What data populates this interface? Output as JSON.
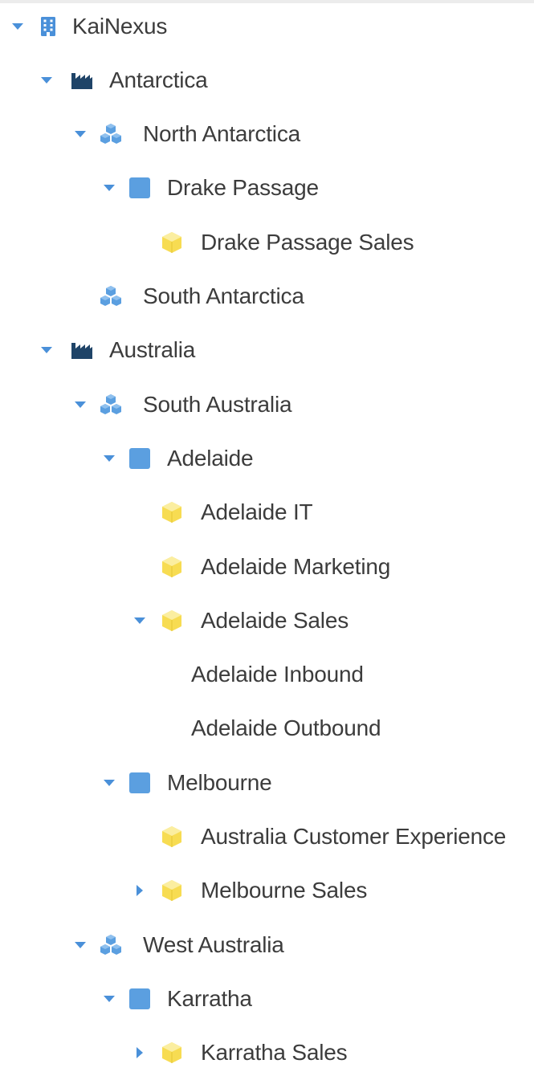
{
  "tree": {
    "colors": {
      "caret": "#4a90d9",
      "org_building": "#4a90d9",
      "region_factory": "#1f4468",
      "area_cubes": "#5b9fe0",
      "site_square": "#5b9fe0",
      "dept_box": "#f7dc52",
      "text": "#3c3c3c"
    },
    "nodes": [
      {
        "label": "KaiNexus",
        "level": 0,
        "toggle": "expanded",
        "icon": "building-icon"
      },
      {
        "label": "Antarctica",
        "level": 1,
        "toggle": "expanded",
        "icon": "factory-icon"
      },
      {
        "label": "North Antarctica",
        "level": 2,
        "toggle": "expanded",
        "icon": "cubes-icon"
      },
      {
        "label": "Drake Passage",
        "level": 3,
        "toggle": "expanded",
        "icon": "square-icon"
      },
      {
        "label": "Drake Passage Sales",
        "level": 4,
        "toggle": "none",
        "icon": "box-icon"
      },
      {
        "label": "South Antarctica",
        "level": 2,
        "toggle": "none",
        "icon": "cubes-icon"
      },
      {
        "label": "Australia",
        "level": 1,
        "toggle": "expanded",
        "icon": "factory-icon"
      },
      {
        "label": "South Australia",
        "level": 2,
        "toggle": "expanded",
        "icon": "cubes-icon"
      },
      {
        "label": "Adelaide",
        "level": 3,
        "toggle": "expanded",
        "icon": "square-icon"
      },
      {
        "label": "Adelaide IT",
        "level": 4,
        "toggle": "none",
        "icon": "box-icon"
      },
      {
        "label": "Adelaide Marketing",
        "level": 4,
        "toggle": "none",
        "icon": "box-icon"
      },
      {
        "label": "Adelaide Sales",
        "level": 4,
        "toggle": "expanded",
        "icon": "box-icon"
      },
      {
        "label": "Adelaide Inbound",
        "level": 5,
        "toggle": "none",
        "icon": "none"
      },
      {
        "label": "Adelaide Outbound",
        "level": 5,
        "toggle": "none",
        "icon": "none"
      },
      {
        "label": "Melbourne",
        "level": 3,
        "toggle": "expanded",
        "icon": "square-icon"
      },
      {
        "label": "Australia Customer Experience",
        "level": 4,
        "toggle": "none",
        "icon": "box-icon"
      },
      {
        "label": "Melbourne Sales",
        "level": 4,
        "toggle": "collapsed",
        "icon": "box-icon"
      },
      {
        "label": "West Australia",
        "level": 2,
        "toggle": "expanded",
        "icon": "cubes-icon"
      },
      {
        "label": "Karratha",
        "level": 3,
        "toggle": "expanded",
        "icon": "square-icon"
      },
      {
        "label": "Karratha Sales",
        "level": 4,
        "toggle": "collapsed",
        "icon": "box-icon"
      }
    ]
  }
}
